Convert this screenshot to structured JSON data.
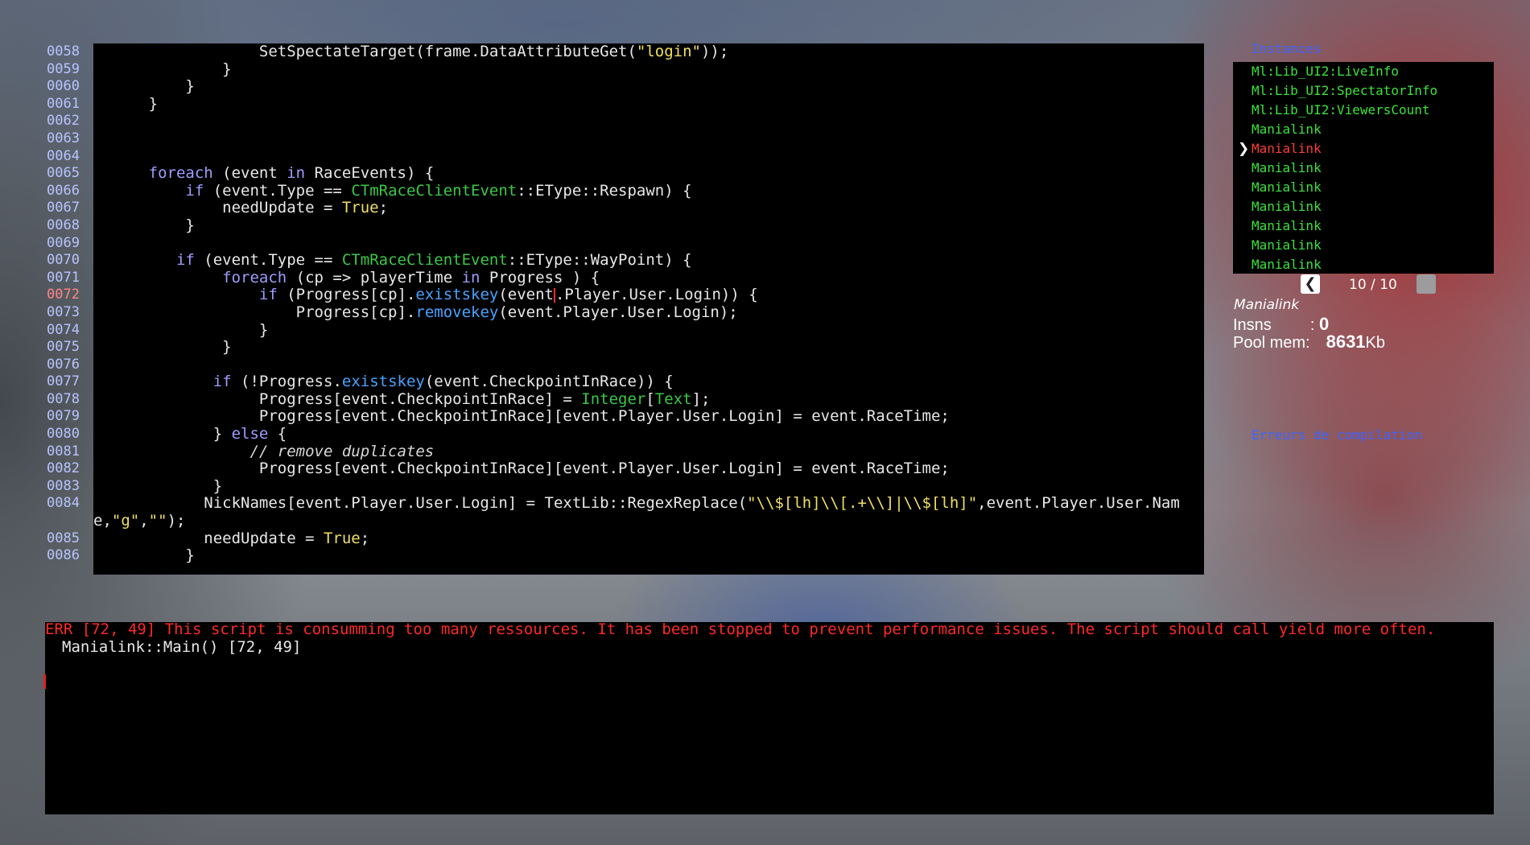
{
  "editor": {
    "line_numbers": [
      "0058",
      "0059",
      "0060",
      "0061",
      "0062",
      "0063",
      "0064",
      "0065",
      "0066",
      "0067",
      "0068",
      "0069",
      "0070",
      "0071",
      "0072",
      "0073",
      "0074",
      "0075",
      "0076",
      "0077",
      "0078",
      "0079",
      "0080",
      "0081",
      "0082",
      "0083",
      "0084",
      "",
      "0085",
      "0086"
    ],
    "current_line": "0072"
  },
  "instances": {
    "title": "Instances",
    "items": [
      "Ml:Lib_UI2:LiveInfo",
      "Ml:Lib_UI2:SpectatorInfo",
      "Ml:Lib_UI2:ViewersCount",
      "Manialink",
      "Manialink",
      "Manialink",
      "Manialink",
      "Manialink",
      "Manialink",
      "Manialink",
      "Manialink"
    ],
    "selected_index": 4,
    "selected_marker": "❯",
    "pager_prev": "❮",
    "pager_text": "10 / 10"
  },
  "info": {
    "name": "Manialink",
    "insns_label": "Insns",
    "insns_sep": ":",
    "insns_value": "0",
    "pool_label": "Pool mem:",
    "pool_value": "8631",
    "pool_unit": "Kb"
  },
  "errors_link": "Erreurs de compilation",
  "console": {
    "error": "ERR [72, 49] This script is consumming too many ressources. It has been stopped to prevent performance issues. The script should call yield more often.",
    "trace": "Manialink::Main() [72, 49]"
  },
  "colors": {
    "keyword": "#9d9dff",
    "type": "#3ac846",
    "method": "#48a3ff",
    "string": "#f0e060",
    "line_number": "#b8c4ff",
    "current_line_number": "#ff8585",
    "instance_item": "#3be23b",
    "instance_selected": "#ff3b3b",
    "link": "#3f64ff",
    "error": "#ff2828"
  }
}
